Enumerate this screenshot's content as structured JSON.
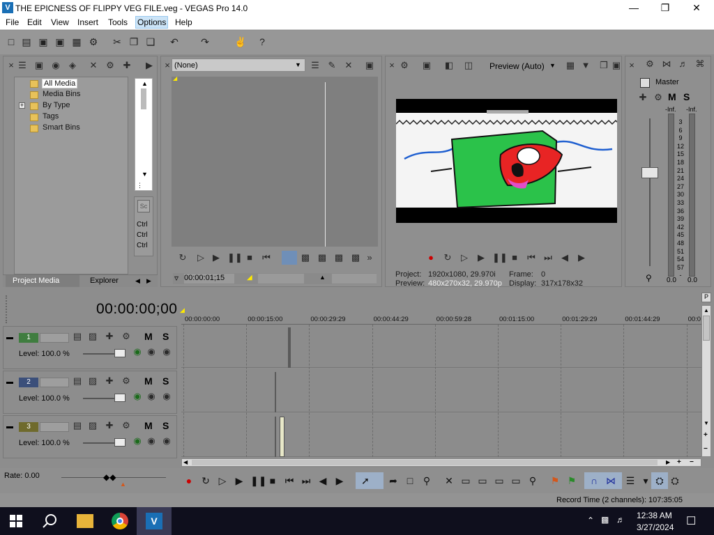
{
  "window": {
    "title": "THE EPICNESS OF FLIPPY VEG FILE.veg - VEGAS Pro 14.0",
    "minimize": "—",
    "maximize": "❐",
    "close": "✕"
  },
  "menu": [
    "File",
    "Edit",
    "View",
    "Insert",
    "Tools",
    "Options",
    "Help"
  ],
  "project_media": {
    "tree": [
      "All Media",
      "Media Bins",
      "By Type",
      "Tags",
      "Smart Bins"
    ],
    "expand": "+",
    "tabs": [
      "Project Media",
      "Explorer"
    ],
    "side": [
      "Ctrl",
      "Ctrl",
      "Ctrl"
    ],
    "side_icon": "Sc"
  },
  "trimmer": {
    "dropdown": "(None)",
    "timecode": "00:00:01;15"
  },
  "preview": {
    "mode": "Preview (Auto)",
    "project_label": "Project:",
    "project_value": "1920x1080, 29.970i",
    "frame_label": "Frame:",
    "frame_value": "0",
    "preview_label": "Preview:",
    "preview_value": "480x270x32, 29.970p",
    "display_label": "Display:",
    "display_value": "317x178x32"
  },
  "mixer": {
    "master": "Master",
    "m": "M",
    "s": "S",
    "inf_left": "-Inf.",
    "inf_right": "-Inf.",
    "scale": [
      "3",
      "6",
      "9",
      "12",
      "15",
      "18",
      "21",
      "24",
      "27",
      "30",
      "33",
      "36",
      "39",
      "42",
      "45",
      "48",
      "51",
      "54",
      "57",
      "-"
    ],
    "bottom_left": "0.0",
    "bottom_right": "0.0"
  },
  "timeline": {
    "timecode": "00:00:00;00",
    "ruler": [
      "00:00:00:00",
      "00:00:15:00",
      "00:00:29:29",
      "00:00:44:29",
      "00:00:59:28",
      "00:01:15:00",
      "00:01:29:29",
      "00:01:44:29",
      "00:0"
    ],
    "tracks": [
      {
        "num": "1",
        "level": "Level: 100.0 %",
        "m": "M",
        "s": "S"
      },
      {
        "num": "2",
        "level": "Level: 100.0 %",
        "m": "M",
        "s": "S"
      },
      {
        "num": "3",
        "level": "Level: 100.0 %",
        "m": "M",
        "s": "S"
      }
    ],
    "rate": "Rate: 0.00"
  },
  "status": {
    "record_time": "Record Time (2 channels): 107:35:05"
  },
  "taskbar": {
    "time": "12:38 AM",
    "date": "3/27/2024"
  },
  "colors": {
    "track1": "#3f7d3f",
    "track2": "#3b4f7a",
    "track3": "#6f6a2c",
    "accent": "#1a6fb5"
  }
}
